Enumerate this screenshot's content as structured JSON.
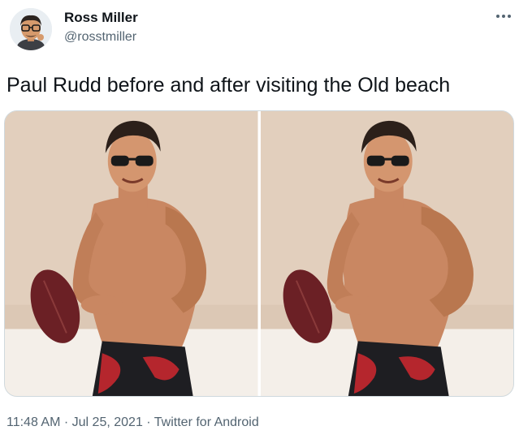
{
  "author": {
    "name": "Ross Miller",
    "handle": "@rosstmiller",
    "avatar_icon": "memoji-avatar-icon"
  },
  "more_icon": "more-options-icon",
  "tweet": {
    "text": "Paul Rudd before and after visiting the Old beach"
  },
  "media": {
    "photos": [
      {
        "alt_icon": "photo-before"
      },
      {
        "alt_icon": "photo-after"
      }
    ]
  },
  "meta": {
    "time": "11:48 AM",
    "separator": "·",
    "date": "Jul 25, 2021",
    "source": "Twitter for Android"
  },
  "colors": {
    "text_primary": "#0f1419",
    "text_secondary": "#536471",
    "border": "#cfd9de"
  }
}
